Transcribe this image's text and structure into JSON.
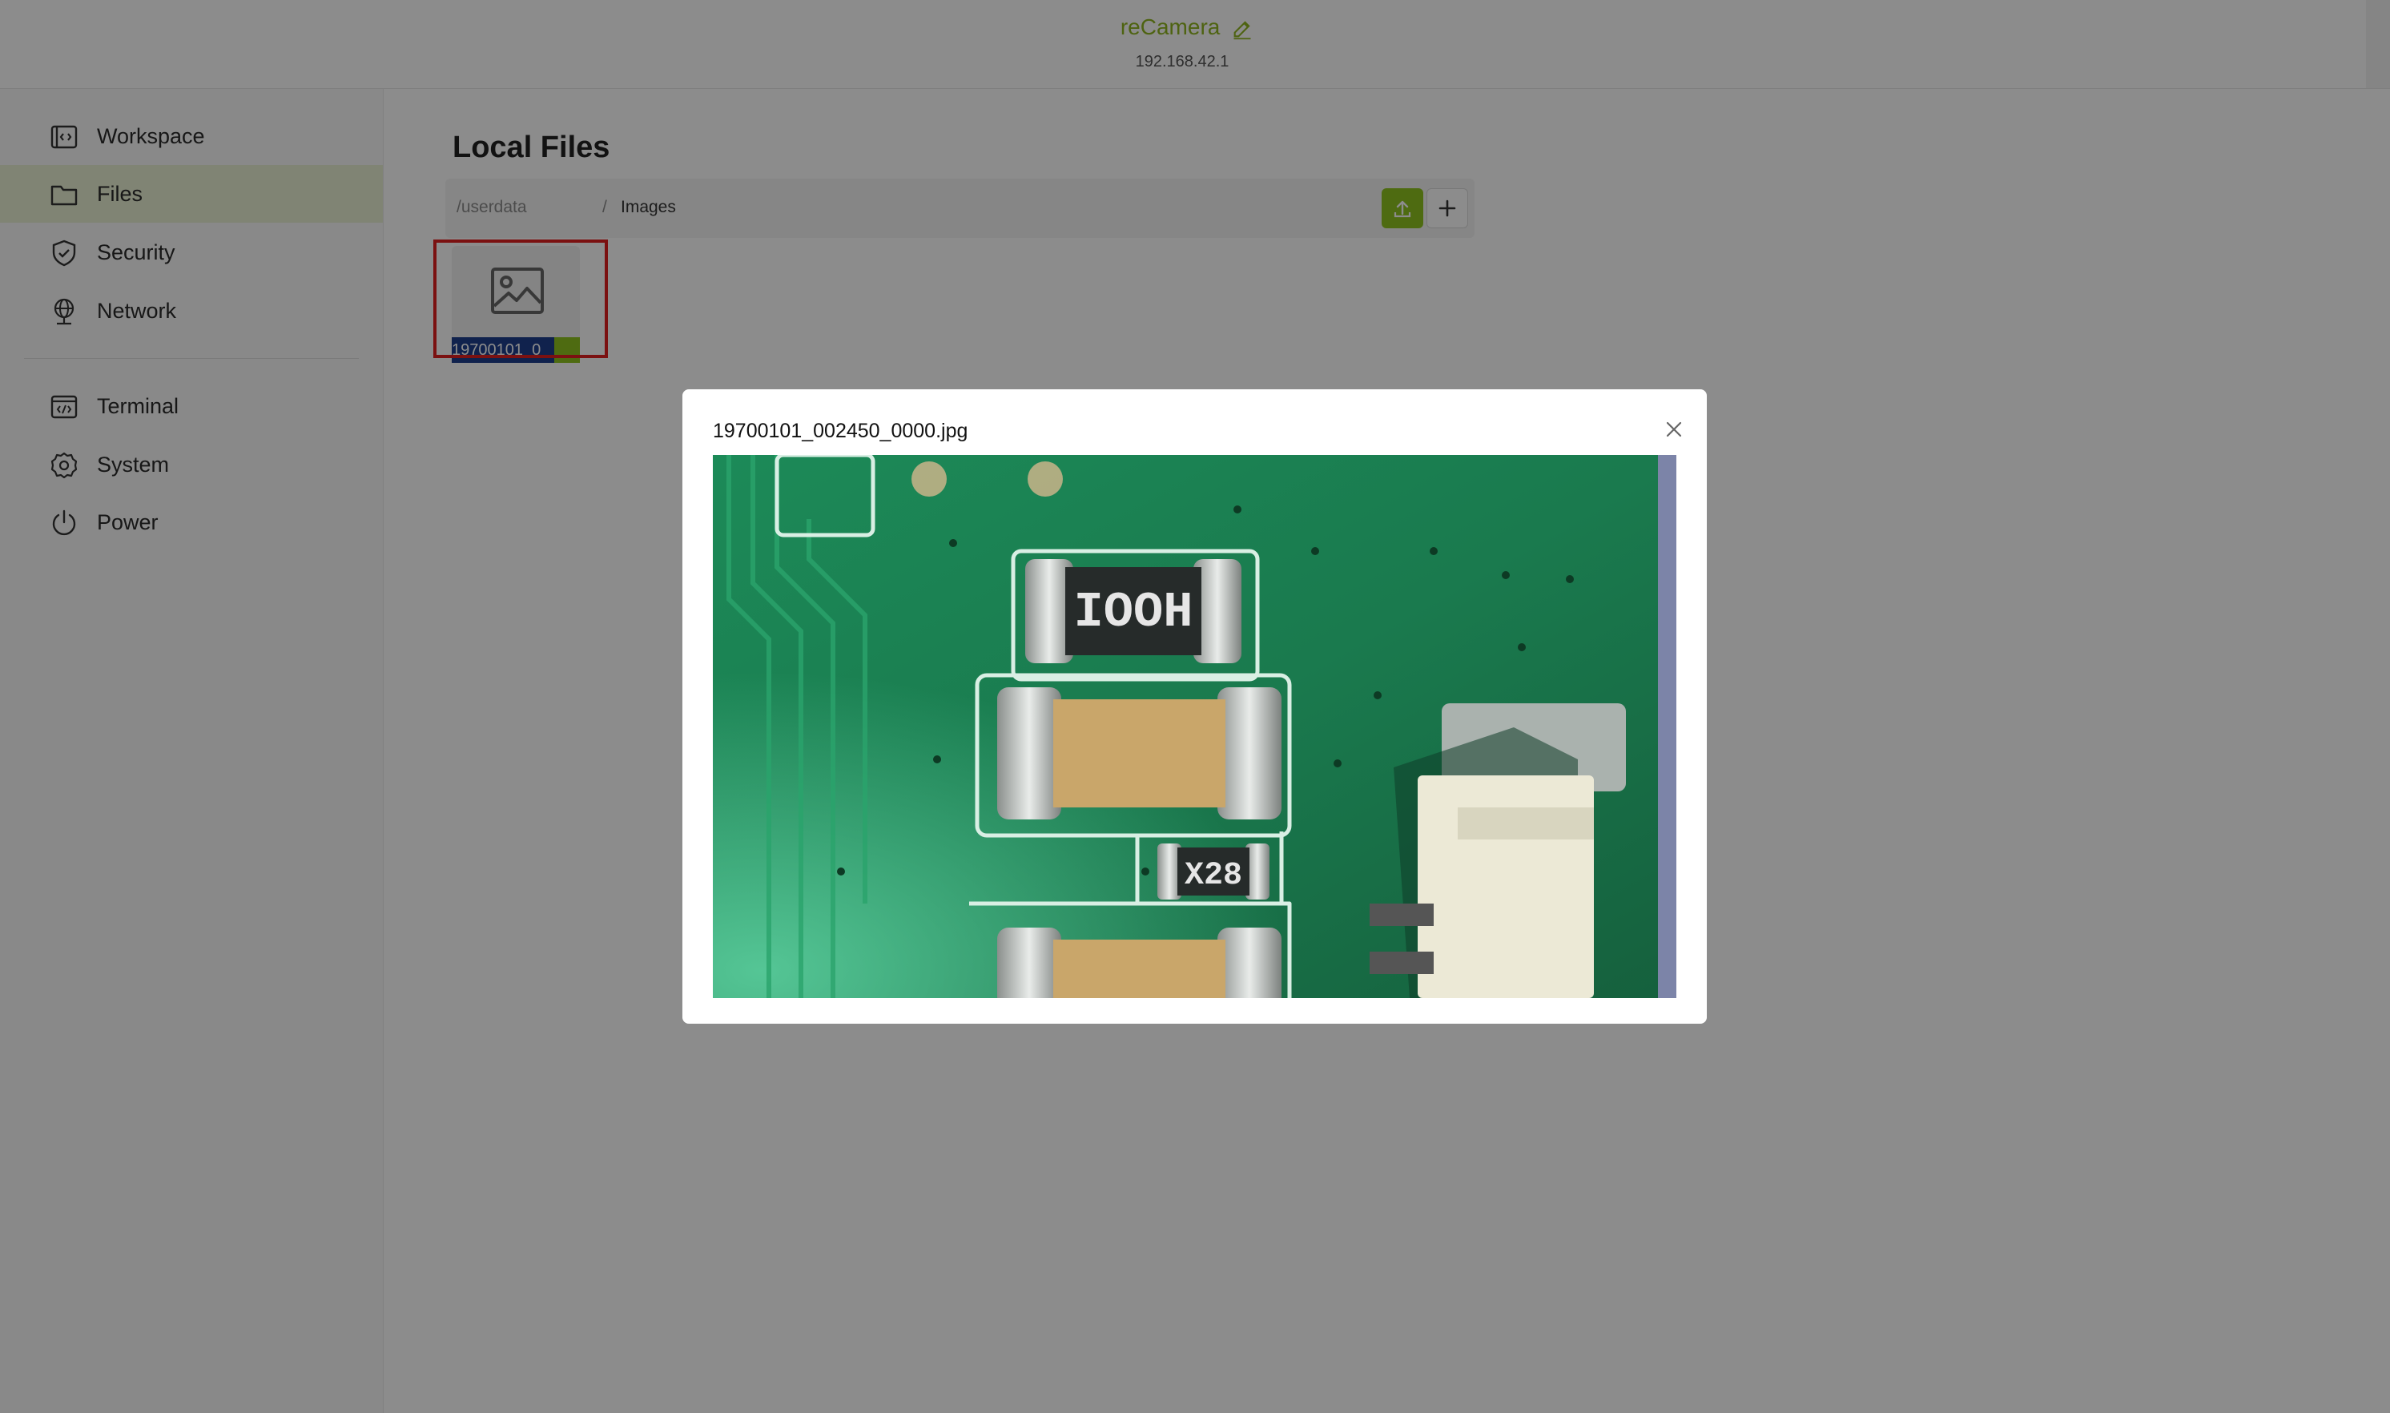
{
  "header": {
    "device_name": "reCamera",
    "device_ip": "192.168.42.1"
  },
  "sidebar": {
    "items": [
      {
        "label": "Workspace",
        "icon": "code-window-icon",
        "active": false
      },
      {
        "label": "Files",
        "icon": "folder-icon",
        "active": true
      },
      {
        "label": "Security",
        "icon": "shield-icon",
        "active": false
      },
      {
        "label": "Network",
        "icon": "globe-icon",
        "active": false
      }
    ],
    "items2": [
      {
        "label": "Terminal",
        "icon": "terminal-icon"
      },
      {
        "label": "System",
        "icon": "gear-icon"
      },
      {
        "label": "Power",
        "icon": "power-icon"
      }
    ]
  },
  "main": {
    "title": "Local Files",
    "breadcrumb": {
      "root": "/userdata",
      "separator": "/",
      "current": "Images"
    },
    "files": [
      {
        "name": "19700101_0",
        "type": "image"
      }
    ]
  },
  "modal": {
    "title": "19700101_002450_0000.jpg",
    "image_text": {
      "resistor1": "IOOH",
      "resistor2": "X28"
    }
  },
  "colors": {
    "accent": "#8fc31f",
    "active_nav_bg": "#e9f1d4",
    "highlight": "#e02020"
  }
}
